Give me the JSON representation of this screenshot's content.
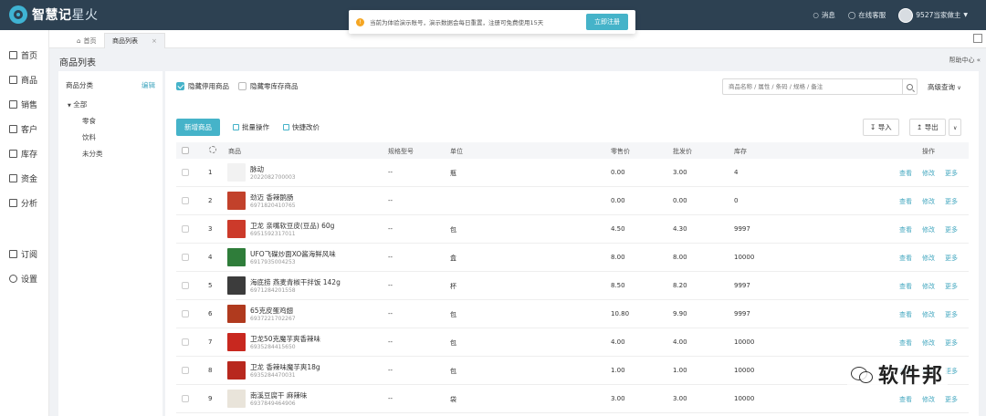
{
  "app": {
    "logo_main": "智慧记",
    "logo_sub": "星火"
  },
  "topbar": {
    "messages": "消息",
    "support": "在线客服",
    "user": "9527当家做主"
  },
  "notice": {
    "text": "当前为体验演示账号，演示数据会每日重置，注册可免费使用15天",
    "button": "立即注册"
  },
  "sidenav": [
    {
      "label": "首页",
      "icon": "home-icon"
    },
    {
      "label": "商品",
      "icon": "goods-icon"
    },
    {
      "label": "销售",
      "icon": "sales-icon"
    },
    {
      "label": "客户",
      "icon": "customer-icon"
    },
    {
      "label": "库存",
      "icon": "inventory-icon"
    },
    {
      "label": "资金",
      "icon": "funds-icon"
    },
    {
      "label": "分析",
      "icon": "analysis-icon"
    },
    {
      "label": "订阅",
      "icon": "subscribe-icon"
    },
    {
      "label": "设置",
      "icon": "settings-icon"
    }
  ],
  "tabs": [
    {
      "label": "首页"
    },
    {
      "label": "商品列表"
    }
  ],
  "page": {
    "title": "商品列表",
    "help": "帮助中心"
  },
  "category": {
    "header": "商品分类",
    "edit": "编辑",
    "root": "全部",
    "children": [
      "零食",
      "饮料",
      "未分类"
    ]
  },
  "filters": {
    "hide_disabled": "隐藏停用商品",
    "hide_zero_stock": "隐藏零库存商品",
    "search_placeholder": "商品名称 / 属性 / 条码 / 规格 / 备注",
    "advanced": "高级查询"
  },
  "toolbar": {
    "add": "新增商品",
    "batch": "批量操作",
    "quick_price": "快捷改价",
    "import": "导入",
    "export": "导出"
  },
  "table": {
    "headers": {
      "product": "商品",
      "spec": "规格型号",
      "unit": "单位",
      "retail": "零售价",
      "wholesale": "批发价",
      "stock": "库存",
      "ops": "操作"
    },
    "actions": {
      "view": "查看",
      "edit": "修改",
      "more": "更多"
    },
    "rows": [
      {
        "no": "1",
        "name": "脉动",
        "code": "2022082700003",
        "spec": "--",
        "unit": "瓶",
        "retail": "0.00",
        "wholesale": "3.00",
        "stock": "4"
      },
      {
        "no": "2",
        "name": "劲迈 香辣鹅肠",
        "code": "6971820410765",
        "spec": "--",
        "unit": "",
        "retail": "0.00",
        "wholesale": "0.00",
        "stock": "0"
      },
      {
        "no": "3",
        "name": "卫龙 亲嘴软豆皮(豆品) 60g",
        "code": "6951592317011",
        "spec": "--",
        "unit": "包",
        "retail": "4.50",
        "wholesale": "4.30",
        "stock": "9997"
      },
      {
        "no": "4",
        "name": "UFO飞碟炒面XO酱海鲜风味",
        "code": "6917935004253",
        "spec": "--",
        "unit": "盒",
        "retail": "8.00",
        "wholesale": "8.00",
        "stock": "10000"
      },
      {
        "no": "5",
        "name": "海底捞 燕麦青椒干拌饭 142g",
        "code": "6971284201558",
        "spec": "--",
        "unit": "杯",
        "retail": "8.50",
        "wholesale": "8.20",
        "stock": "9997"
      },
      {
        "no": "6",
        "name": "65克皮蛋鸡翅",
        "code": "6937221702267",
        "spec": "--",
        "unit": "包",
        "retail": "10.80",
        "wholesale": "9.90",
        "stock": "9997"
      },
      {
        "no": "7",
        "name": "卫龙50克魔芋爽香辣味",
        "code": "6935284415650",
        "spec": "--",
        "unit": "包",
        "retail": "4.00",
        "wholesale": "4.00",
        "stock": "10000"
      },
      {
        "no": "8",
        "name": "卫龙 香辣味魔芋爽18g",
        "code": "6935284470031",
        "spec": "--",
        "unit": "包",
        "retail": "1.00",
        "wholesale": "1.00",
        "stock": "10000"
      },
      {
        "no": "9",
        "name": "南溪豆腐干 麻辣味",
        "code": "6937849464906",
        "spec": "--",
        "unit": "袋",
        "retail": "3.00",
        "wholesale": "3.00",
        "stock": "10000"
      }
    ]
  },
  "watermark": "软件邦",
  "colors": {
    "topbar": "#2d4152",
    "accent": "#45b3c9",
    "link": "#45a8c0"
  }
}
